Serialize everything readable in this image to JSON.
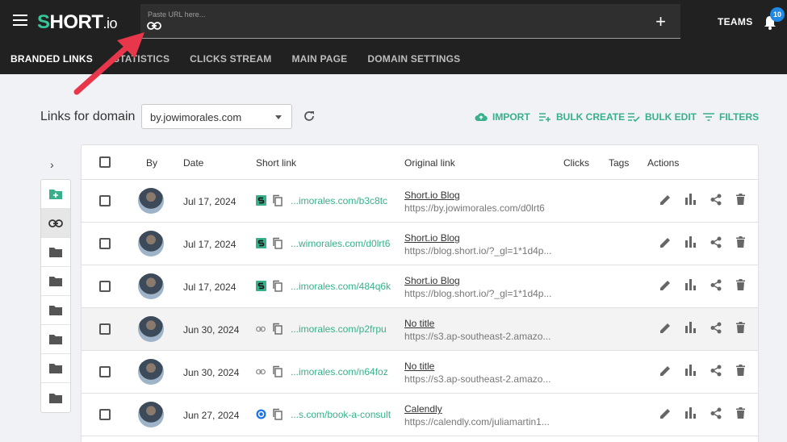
{
  "header": {
    "logo": {
      "mark": "S",
      "text": "HORT",
      "suffix": ".io"
    },
    "url_placeholder": "Paste URL here...",
    "teams_label": "TEAMS",
    "notification_count": "10"
  },
  "nav": {
    "tabs": [
      {
        "label": "BRANDED LINKS",
        "active": true
      },
      {
        "label": "STATISTICS",
        "active": false
      },
      {
        "label": "CLICKS STREAM",
        "active": false
      },
      {
        "label": "MAIN PAGE",
        "active": false
      },
      {
        "label": "DOMAIN SETTINGS",
        "active": false
      }
    ]
  },
  "domain": {
    "label": "Links for domain",
    "selected": "by.jowimorales.com"
  },
  "actions": {
    "import": "IMPORT",
    "bulk_create": "BULK CREATE",
    "bulk_edit": "BULK EDIT",
    "filters": "FILTERS"
  },
  "table": {
    "headers": {
      "by": "By",
      "date": "Date",
      "short_link": "Short link",
      "original_link": "Original link",
      "clicks": "Clicks",
      "tags": "Tags",
      "actions": "Actions"
    },
    "rows": [
      {
        "date": "Jul 17, 2024",
        "source": "shortio",
        "short": "...imorales.com/b3c8tc",
        "title": "Short.io Blog",
        "url": "https://by.jowimorales.com/d0lrt6"
      },
      {
        "date": "Jul 17, 2024",
        "source": "shortio",
        "short": "...wimorales.com/d0lrt6",
        "title": "Short.io Blog",
        "url": "https://blog.short.io/?_gl=1*1d4p..."
      },
      {
        "date": "Jul 17, 2024",
        "source": "shortio",
        "short": "...imorales.com/484q6k",
        "title": "Short.io Blog",
        "url": "https://blog.short.io/?_gl=1*1d4p..."
      },
      {
        "date": "Jun 30, 2024",
        "source": "link",
        "short": "...imorales.com/p2frpu",
        "title": "No title",
        "url": "https://s3.ap-southeast-2.amazo..."
      },
      {
        "date": "Jun 30, 2024",
        "source": "link",
        "short": "...imorales.com/n64foz",
        "title": "No title",
        "url": "https://s3.ap-southeast-2.amazo..."
      },
      {
        "date": "Jun 27, 2024",
        "source": "calendly",
        "short": "...s.com/book-a-consult",
        "title": "Calendly",
        "url": "https://calendly.com/juliamartin1..."
      }
    ]
  },
  "colors": {
    "accent": "#37b08b",
    "topbar": "#212121",
    "badge": "#1e88e5",
    "annotation_arrow": "#e8374a"
  }
}
